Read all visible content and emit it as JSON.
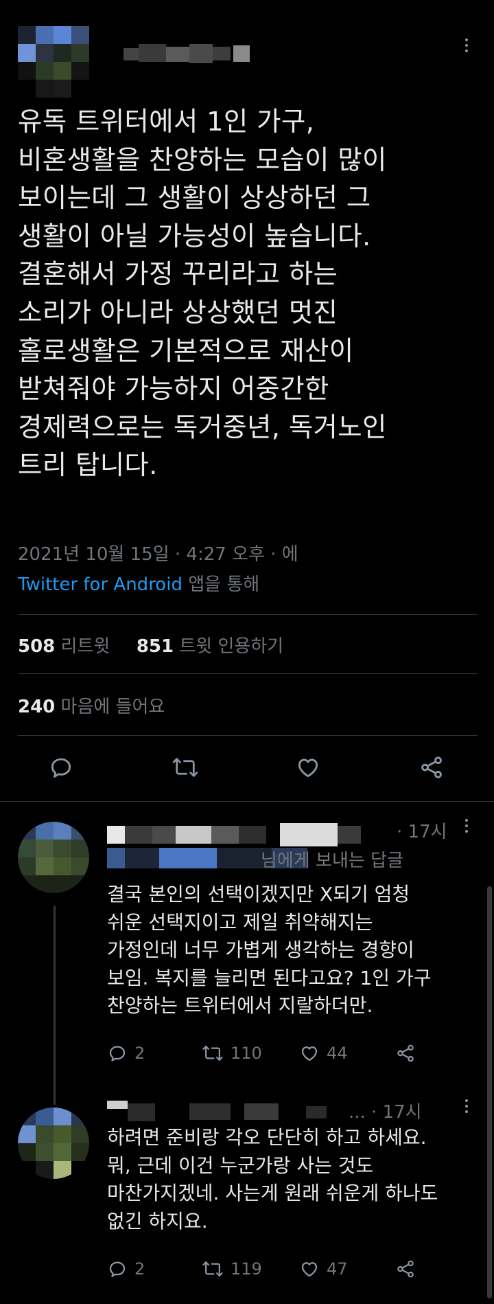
{
  "tweet": {
    "author_name_blurred": "",
    "text": "유독 트위터에서 1인 가구,\n비혼생활을 찬양하는 모습이 많이\n보이는데 그 생활이 상상하던 그\n생활이 아닐 가능성이 높습니다.\n결혼해서 가정 꾸리라고 하는\n소리가 아니라 상상했던 멋진\n홀로생활은 기본적으로 재산이\n받쳐줘야 가능하지 어중간한\n경제력으로는 독거중년, 독거노인\n트리 탑니다.",
    "timestamp": "2021년 10월 15일 · 4:27 오후 · 에",
    "source_app": "Twitter for Android",
    "source_suffix": " 앱을 통해",
    "retweets_count": "508",
    "retweets_label": " 리트윗",
    "quotes_count": "851",
    "quotes_label": " 트윗 인용하기",
    "likes_count": "240",
    "likes_label": " 마음에 들어요"
  },
  "replies": [
    {
      "time": "· 17시",
      "reply_to_suffix": "님에게 보내는 답글",
      "text": "결국 본인의 선택이겠지만 X되기 엄청\n쉬운 선택지이고 제일 취약해지는\n가정인데 너무 가볍게 생각하는 경향이\n보임. 복지를 늘리면 된다고요? 1인 가구\n찬양하는 트위터에서 지랄하더만.",
      "reply_count": "2",
      "retweet_count": "110",
      "like_count": "44"
    },
    {
      "time": "... · 17시",
      "text": "하려면 준비랑 각오 단단히 하고 하세요.\n뭐, 근데 이건 누군가랑 사는 것도\n마찬가지겠네. 사는게 원래 쉬운게 하나도\n없긴 하지요.",
      "reply_count": "2",
      "retweet_count": "119",
      "like_count": "47"
    }
  ],
  "icons": {
    "reply": "reply-icon",
    "retweet": "retweet-icon",
    "like": "heart-icon",
    "share": "share-icon",
    "more": "more-icon"
  },
  "colors": {
    "background": "#000000",
    "text": "#e7e9ea",
    "secondary": "#71767b",
    "link": "#1d9bf0",
    "divider": "#2f3336"
  }
}
